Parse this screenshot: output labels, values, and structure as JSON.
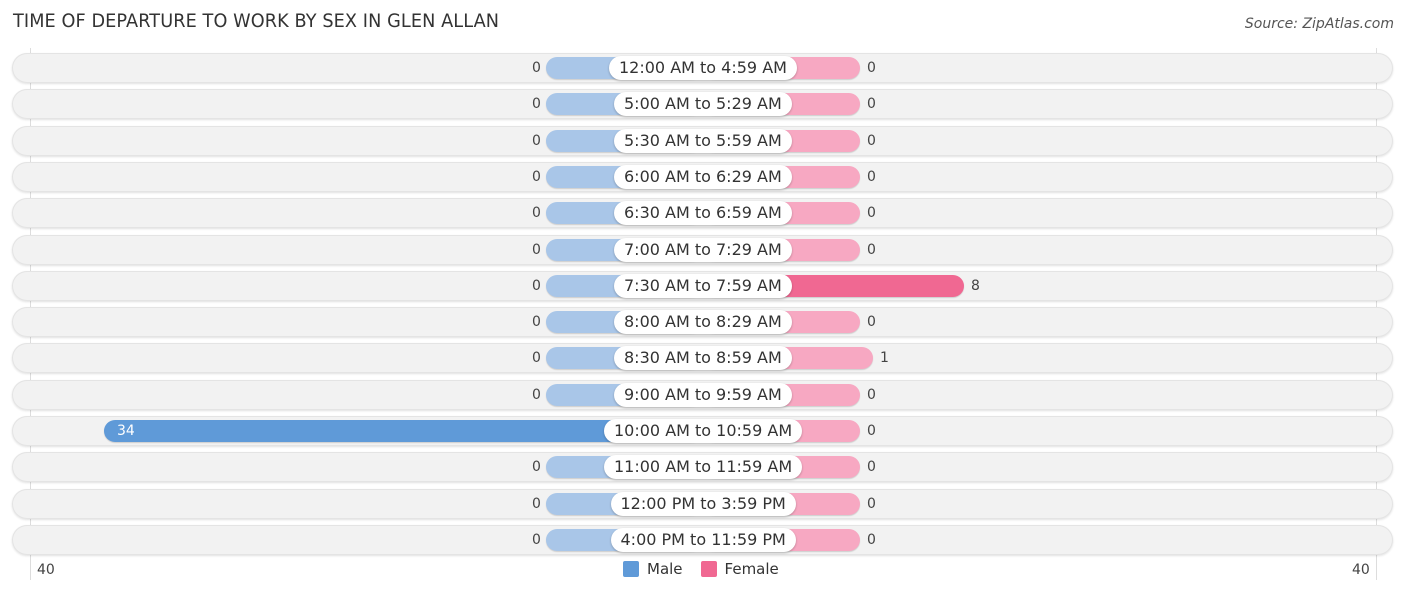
{
  "chart_data": {
    "type": "bar",
    "orientation": "horizontal-diverging",
    "title": "TIME OF DEPARTURE TO WORK BY SEX IN GLEN ALLAN",
    "source": "Source: ZipAtlas.com",
    "categories": [
      "12:00 AM to 4:59 AM",
      "5:00 AM to 5:29 AM",
      "5:30 AM to 5:59 AM",
      "6:00 AM to 6:29 AM",
      "6:30 AM to 6:59 AM",
      "7:00 AM to 7:29 AM",
      "7:30 AM to 7:59 AM",
      "8:00 AM to 8:29 AM",
      "8:30 AM to 8:59 AM",
      "9:00 AM to 9:59 AM",
      "10:00 AM to 10:59 AM",
      "11:00 AM to 11:59 AM",
      "12:00 PM to 3:59 PM",
      "4:00 PM to 11:59 PM"
    ],
    "series": [
      {
        "name": "Male",
        "color": "#5f9ad8",
        "light_color": "#a9c6e8",
        "values": [
          0,
          0,
          0,
          0,
          0,
          0,
          0,
          0,
          0,
          0,
          34,
          0,
          0,
          0
        ]
      },
      {
        "name": "Female",
        "color": "#f06892",
        "light_color": "#f7a8c2",
        "values": [
          0,
          0,
          0,
          0,
          0,
          0,
          8,
          0,
          1,
          0,
          0,
          0,
          0,
          0
        ]
      }
    ],
    "axis": {
      "left_max_label": "40",
      "right_max_label": "40",
      "range": [
        0,
        40
      ]
    },
    "legend": {
      "position": "bottom-center",
      "items": [
        "Male",
        "Female"
      ]
    },
    "grid": false
  }
}
